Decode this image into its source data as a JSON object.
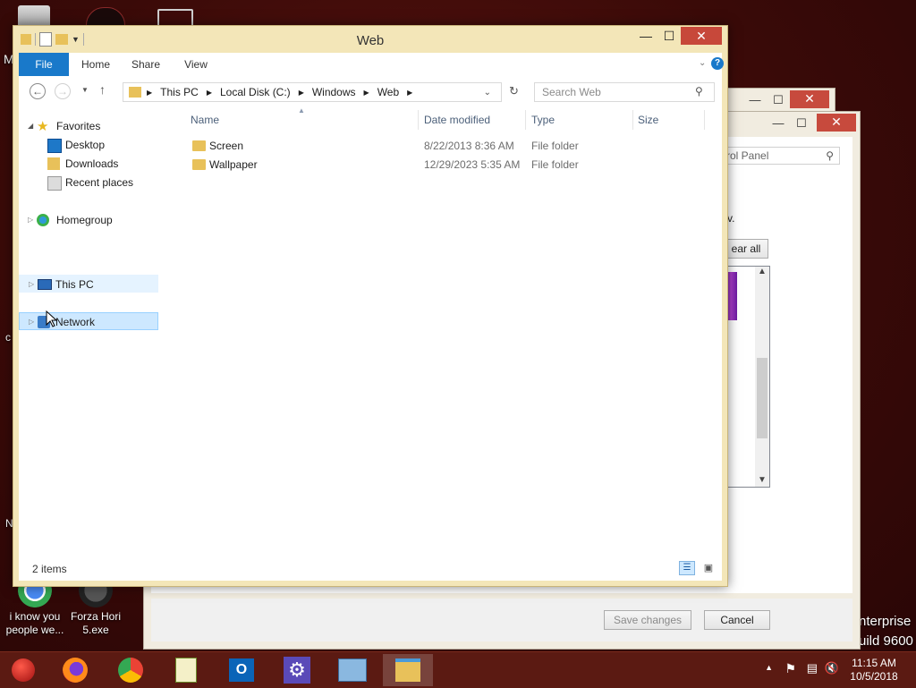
{
  "desktop": {
    "icons": [
      {
        "label": "i know you people we..."
      },
      {
        "label": "Forza Hori 5.exe"
      }
    ],
    "edge_texts": [
      "M",
      "c",
      "N"
    ],
    "watermark": {
      "line1": "nterprise",
      "line2": "uild 9600"
    }
  },
  "control_panel": {
    "search_placeholder": "rol Panel",
    "fragment_text": "v.",
    "clear_all_label": "ear all",
    "save_changes_label": "Save changes",
    "cancel_label": "Cancel"
  },
  "explorer": {
    "title": "Web",
    "tabs": [
      "File",
      "Home",
      "Share",
      "View"
    ],
    "breadcrumb": [
      "This PC",
      "Local Disk (C:)",
      "Windows",
      "Web"
    ],
    "search_placeholder": "Search Web",
    "nav": {
      "favorites": "Favorites",
      "desktop": "Desktop",
      "downloads": "Downloads",
      "recent_places": "Recent places",
      "homegroup": "Homegroup",
      "this_pc": "This PC",
      "network": "Network"
    },
    "columns": {
      "name": "Name",
      "date_modified": "Date modified",
      "type": "Type",
      "size": "Size"
    },
    "files": [
      {
        "name": "Screen",
        "date": "8/22/2013 8:36 AM",
        "type": "File folder",
        "size": ""
      },
      {
        "name": "Wallpaper",
        "date": "12/29/2023 5:35 AM",
        "type": "File folder",
        "size": ""
      }
    ],
    "status": "2 items"
  },
  "taskbar": {
    "apps": [
      "start-orb",
      "firefox",
      "chrome",
      "notepad-plus",
      "outlook",
      "settings",
      "remote-desktop",
      "file-explorer"
    ],
    "clock_time": "11:15 AM",
    "clock_date": "10/5/2018"
  },
  "colors": {
    "accent": "#1979ca",
    "frame": "#f3e6b8",
    "taskbar": "#5b1a12",
    "close": "#c7483a"
  }
}
